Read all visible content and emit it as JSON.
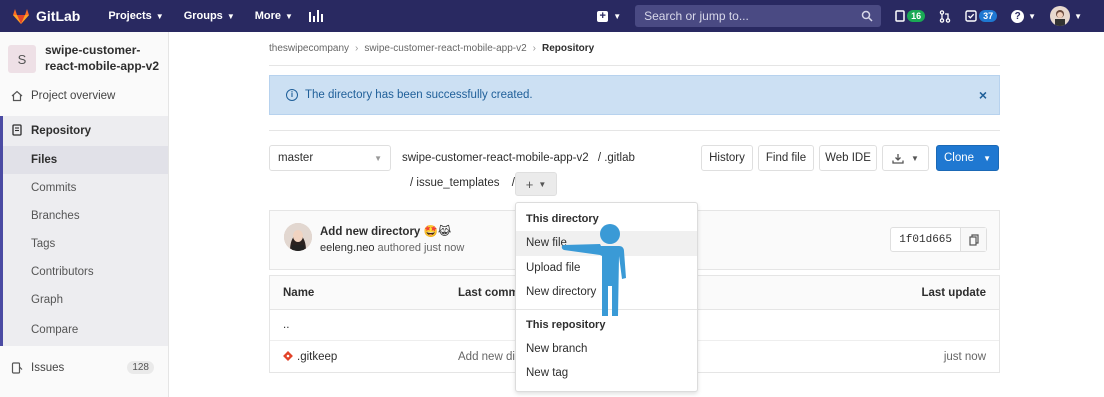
{
  "navbar": {
    "brand": "GitLab",
    "links": [
      "Projects",
      "Groups",
      "More"
    ],
    "search_placeholder": "Search or jump to...",
    "mr_count": "16",
    "todo_count": "37",
    "colors": {
      "bg": "#292961",
      "search": "#4a4a83"
    }
  },
  "sidebar": {
    "project_initial": "S",
    "project_name": "swipe-customer-react-mobile-app-v2",
    "items": {
      "overview": "Project overview",
      "repository": "Repository",
      "files": "Files",
      "commits": "Commits",
      "branches": "Branches",
      "tags": "Tags",
      "contributors": "Contributors",
      "graph": "Graph",
      "compare": "Compare",
      "issues": "Issues",
      "issues_count": "128"
    }
  },
  "breadcrumb": {
    "group": "theswipecompany",
    "project": "swipe-customer-react-mobile-app-v2",
    "current": "Repository"
  },
  "flash": {
    "message": "The directory has been successfully created.",
    "close": "×"
  },
  "tree": {
    "branch": "master",
    "path_root": "swipe-customer-react-mobile-app-v2",
    "path_dir1": "/ .gitlab",
    "path_dir2": "/ issue_templates",
    "path_sep": "/",
    "buttons": {
      "history": "History",
      "find_file": "Find file",
      "web_ide": "Web IDE",
      "clone": "Clone"
    }
  },
  "commit": {
    "title": "Add new directory 🤩😹",
    "author": "eeleng.neo",
    "meta": " authored just now",
    "sha": "1f01d665"
  },
  "files": {
    "headers": {
      "name": "Name",
      "last_commit": "Last commit",
      "last_update": "Last update"
    },
    "rows": [
      {
        "name": "..",
        "commit": "",
        "update": ""
      },
      {
        "name": ".gitkeep",
        "commit": "Add new directory",
        "update": "just now"
      }
    ]
  },
  "dropdown": {
    "this_directory": "This directory",
    "new_file": "New file",
    "upload_file": "Upload file",
    "new_directory": "New directory",
    "this_repository": "This repository",
    "new_branch": "New branch",
    "new_tag": "New tag"
  }
}
